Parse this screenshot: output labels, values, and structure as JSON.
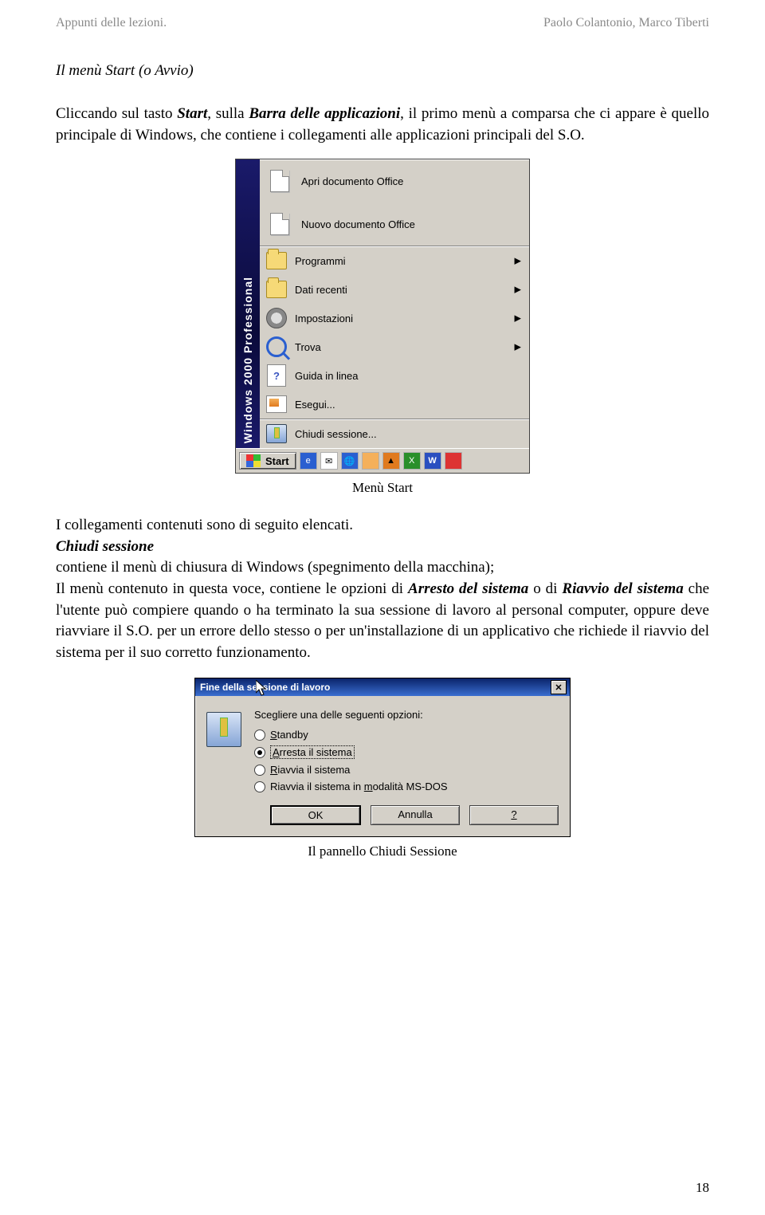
{
  "header": {
    "left": "Appunti delle lezioni.",
    "right": "Paolo Colantonio, Marco Tiberti"
  },
  "section_title": "Il menù Start (o Avvio)",
  "paragraph1_parts": {
    "a": "Cliccando sul tasto ",
    "b": "Start",
    "c": ", sulla ",
    "d": "Barra delle applicazioni",
    "e": ", il primo menù a comparsa che ci appare è quello principale di Windows, che contiene i collegamenti alle applicazioni principali del S.O."
  },
  "start_menu": {
    "sideband": "Windows 2000 Professional",
    "items": [
      {
        "label": "Apri documento Office",
        "has_arrow": false,
        "tall": true
      },
      {
        "label": "Nuovo documento Office",
        "has_arrow": false,
        "tall": true
      },
      {
        "label": "Programmi",
        "has_arrow": true,
        "tall": false
      },
      {
        "label": "Dati recenti",
        "has_arrow": true,
        "tall": false
      },
      {
        "label": "Impostazioni",
        "has_arrow": true,
        "tall": false
      },
      {
        "label": "Trova",
        "has_arrow": true,
        "tall": false
      },
      {
        "label": "Guida in linea",
        "has_arrow": false,
        "tall": false
      },
      {
        "label": "Esegui...",
        "has_arrow": false,
        "tall": false
      },
      {
        "label": "Chiudi sessione...",
        "has_arrow": false,
        "tall": false
      }
    ],
    "start_button": "Start"
  },
  "caption1": "Menù Start",
  "para2_line1": "I collegamenti contenuti sono di seguito elencati.",
  "para2_head": "Chiudi sessione",
  "para2_body_a": "contiene il menù di chiusura di Windows (spegnimento della macchina);",
  "para2_body_b": "Il menù contenuto in questa voce, contiene le opzioni di ",
  "para2_arresto": "Arresto del sistema",
  "para2_body_c": " o di ",
  "para2_riavvio": "Riavvio del sistema",
  "para2_body_d": " che l'utente può compiere quando o ha terminato la sua sessione di lavoro al personal computer, oppure deve riavviare il S.O. per un errore dello stesso o per un'installazione di un applicativo che richiede il riavvio del sistema per il suo corretto funzionamento.",
  "dialog": {
    "title": "Fine della sessione di lavoro",
    "prompt": "Scegliere una delle seguenti opzioni:",
    "options": {
      "standby": {
        "letter": "S",
        "rest": "tandby"
      },
      "arresta": {
        "letter": "A",
        "rest": "rresta il sistema"
      },
      "riavvia": {
        "letter": "R",
        "rest": "iavvia il sistema"
      },
      "riavvia_dos": {
        "pre": "Riavvia il sistema in ",
        "letter": "m",
        "post": "odalità MS-DOS"
      }
    },
    "buttons": {
      "ok": "OK",
      "cancel": "Annulla",
      "help": "?"
    }
  },
  "caption2": "Il pannello Chiudi Sessione",
  "page_number": "18"
}
